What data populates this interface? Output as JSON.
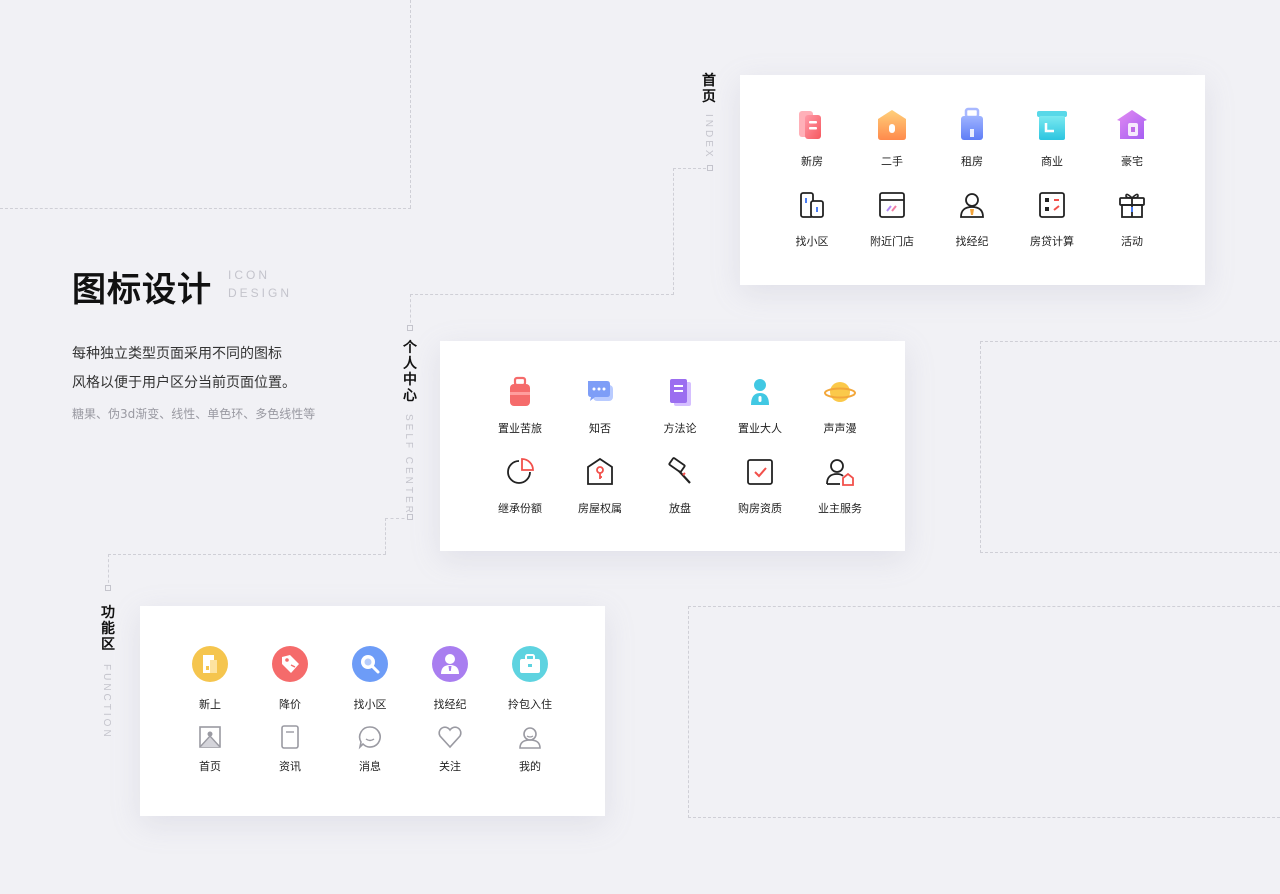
{
  "hero": {
    "title": "图标设计",
    "en_line1": "ICON",
    "en_line2": "DESIGN",
    "desc_line1": "每种独立类型页面采用不同的图标",
    "desc_line2": "风格以便于用户区分当前页面位置。",
    "sub": "糖果、伪3d渐变、线性、单色环、多色线性等"
  },
  "sections": {
    "index": {
      "label": "首页",
      "en": "INDEX",
      "row1": [
        {
          "label": "新房",
          "icon": "new-house-icon"
        },
        {
          "label": "二手",
          "icon": "second-hand-house-icon"
        },
        {
          "label": "租房",
          "icon": "rent-luggage-icon"
        },
        {
          "label": "商业",
          "icon": "commercial-shop-icon"
        },
        {
          "label": "豪宅",
          "icon": "mansion-icon"
        }
      ],
      "row2": [
        {
          "label": "找小区",
          "icon": "community-icon"
        },
        {
          "label": "附近门店",
          "icon": "nearby-store-icon"
        },
        {
          "label": "找经纪",
          "icon": "agent-icon"
        },
        {
          "label": "房贷计算",
          "icon": "calculator-icon"
        },
        {
          "label": "活动",
          "icon": "gift-icon"
        }
      ]
    },
    "self_center": {
      "label": "个人中心",
      "en": "SELF CENTER",
      "row1": [
        {
          "label": "置业苦旅",
          "icon": "suitcase-icon"
        },
        {
          "label": "知否",
          "icon": "chat-bubble-icon"
        },
        {
          "label": "方法论",
          "icon": "book-icon"
        },
        {
          "label": "置业大人",
          "icon": "person-icon"
        },
        {
          "label": "声声漫",
          "icon": "planet-icon"
        }
      ],
      "row2": [
        {
          "label": "继承份额",
          "icon": "pie-share-icon"
        },
        {
          "label": "房屋权属",
          "icon": "house-key-icon"
        },
        {
          "label": "放盘",
          "icon": "hammer-icon"
        },
        {
          "label": "购房资质",
          "icon": "checkbox-icon"
        },
        {
          "label": "业主服务",
          "icon": "owner-service-icon"
        }
      ]
    },
    "function": {
      "label": "功能区",
      "en": "FUNCTION",
      "row1": [
        {
          "label": "新上",
          "icon": "new-listing-icon",
          "color": "#f5c54e"
        },
        {
          "label": "降价",
          "icon": "price-tag-icon",
          "color": "#f56b6b"
        },
        {
          "label": "找小区",
          "icon": "search-icon",
          "color": "#6d9cf7"
        },
        {
          "label": "找经纪",
          "icon": "agent-icon",
          "color": "#a97ef0"
        },
        {
          "label": "拎包入住",
          "icon": "briefcase-icon",
          "color": "#5ed3e0"
        }
      ],
      "row2": [
        {
          "label": "首页",
          "icon": "home-icon"
        },
        {
          "label": "资讯",
          "icon": "news-icon"
        },
        {
          "label": "消息",
          "icon": "message-icon"
        },
        {
          "label": "关注",
          "icon": "heart-icon"
        },
        {
          "label": "我的",
          "icon": "profile-icon"
        }
      ]
    }
  },
  "colors": {
    "background": "#f1f1f5",
    "card": "#ffffff",
    "accent_red": "#f2504b",
    "guide": "#cfcfd6"
  }
}
